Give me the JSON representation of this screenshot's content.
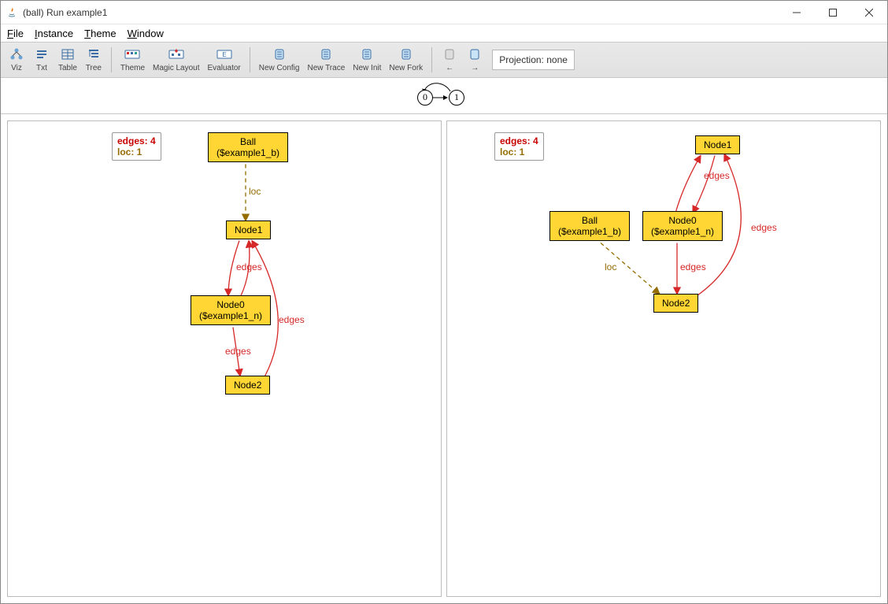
{
  "window": {
    "title": "(ball) Run example1"
  },
  "menu": {
    "file": "File",
    "instance": "Instance",
    "theme": "Theme",
    "window": "Window"
  },
  "toolbar": {
    "viz": "Viz",
    "txt": "Txt",
    "table": "Table",
    "tree": "Tree",
    "theme": "Theme",
    "magic_layout": "Magic Layout",
    "evaluator": "Evaluator",
    "new_config": "New Config",
    "new_trace": "New Trace",
    "new_init": "New Init",
    "new_fork": "New Fork",
    "prev": "←",
    "next": "→",
    "projection_label": "Projection: none"
  },
  "states": {
    "s0": "0",
    "s1": "1"
  },
  "pane0": {
    "info_edges": "edges: 4",
    "info_loc": "loc: 1",
    "ball_l1": "Ball",
    "ball_l2": "($example1_b)",
    "node1": "Node1",
    "node0_l1": "Node0",
    "node0_l2": "($example1_n)",
    "node2": "Node2",
    "label_loc": "loc",
    "label_edges": "edges"
  },
  "pane1": {
    "info_edges": "edges: 4",
    "info_loc": "loc: 1",
    "ball_l1": "Ball",
    "ball_l2": "($example1_b)",
    "node1": "Node1",
    "node0_l1": "Node0",
    "node0_l2": "($example1_n)",
    "node2": "Node2",
    "label_loc": "loc",
    "label_edges": "edges"
  }
}
